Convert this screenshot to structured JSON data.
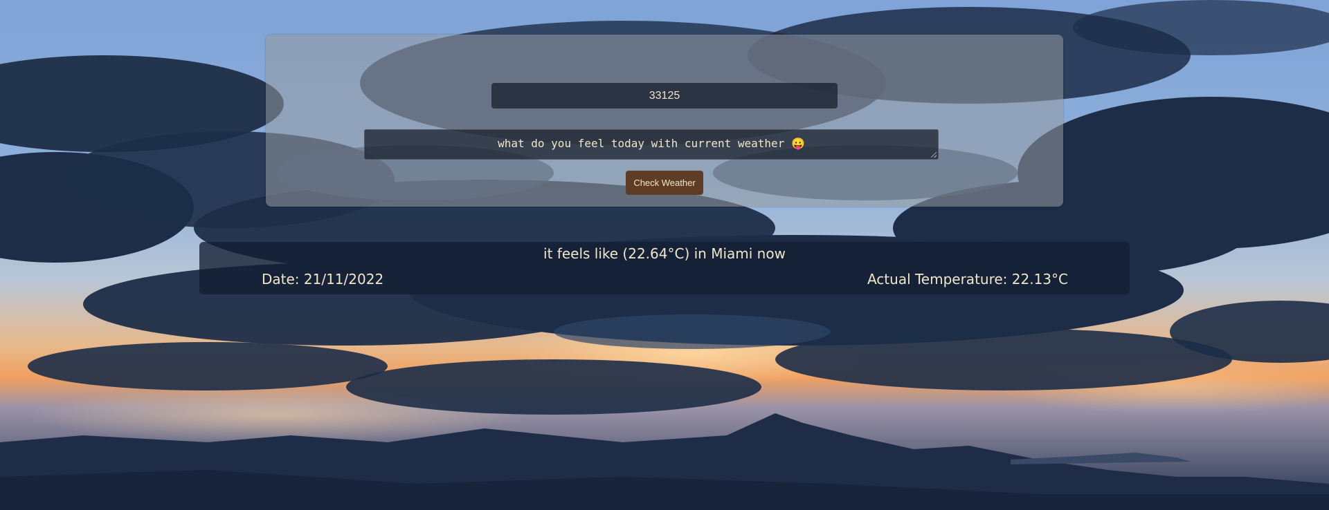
{
  "form": {
    "zip_value": "33125",
    "feeling_value": "what do you feel today with current weather 😛",
    "submit_label": "Check Weather"
  },
  "result": {
    "feels_text": "it feels like (22.64°C) in Miami now",
    "date_text": "Date: 21/11/2022",
    "actual_text": "Actual Temperature: 22.13°C"
  },
  "colors": {
    "text": "#f1e6c9",
    "button": "#5e3c25",
    "card": "rgba(150,155,160,0.55)",
    "result_card": "rgba(18,30,50,0.78)"
  }
}
